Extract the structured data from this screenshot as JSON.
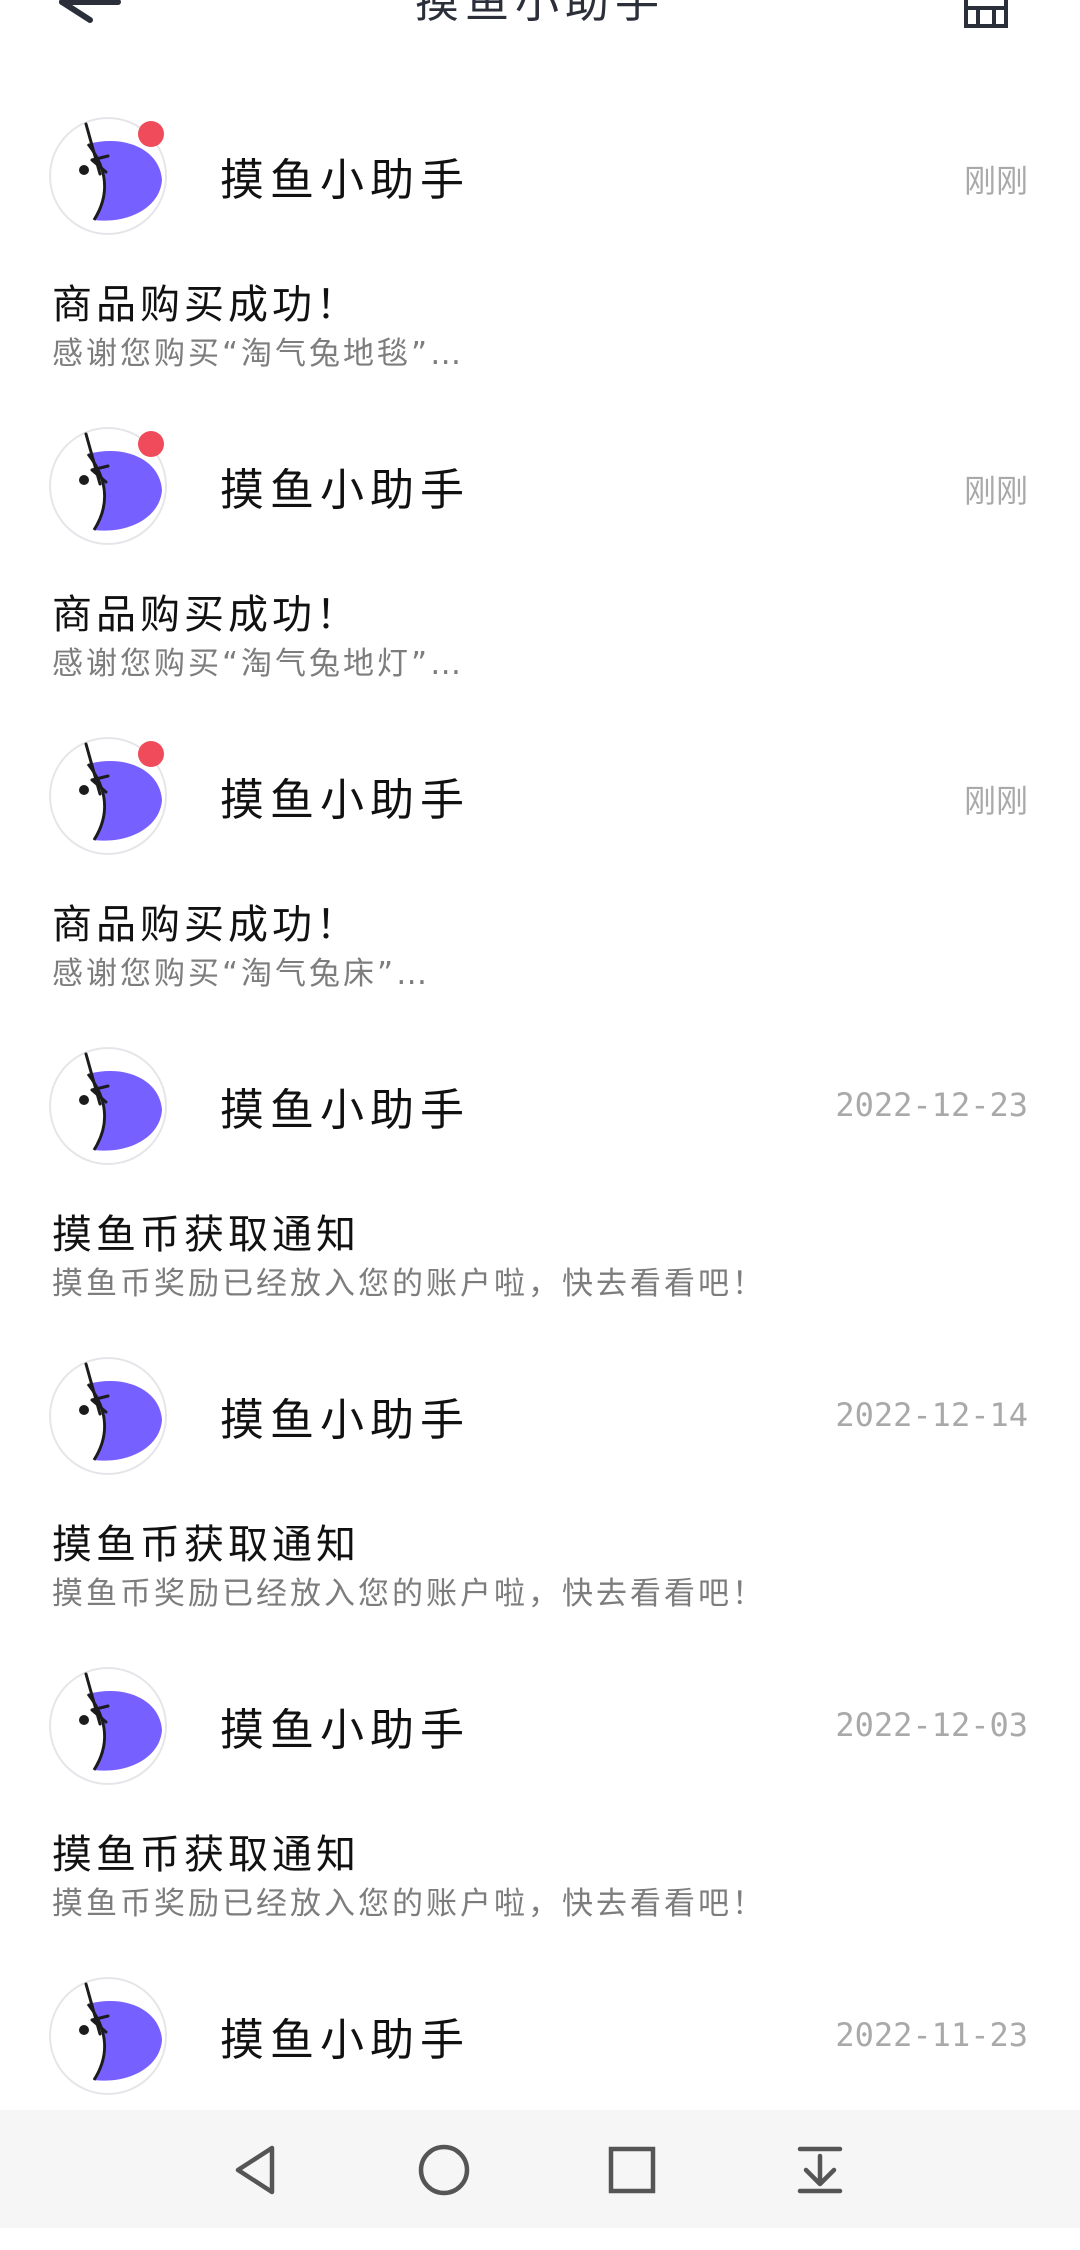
{
  "header": {
    "title": "摸鱼小助手",
    "back_icon": "back-arrow-icon",
    "clear_icon": "broom-clear-icon"
  },
  "colors": {
    "accent": "#7660ff",
    "unread_dot": "#ef4b5b",
    "time_text": "#a9a9a9",
    "desc_text": "#7d7d7d"
  },
  "messages": [
    {
      "sender": "摸鱼小助手",
      "time": "刚刚",
      "title": "商品购买成功！",
      "desc": "感谢您购买“淘气兔地毯”…",
      "unread": true
    },
    {
      "sender": "摸鱼小助手",
      "time": "刚刚",
      "title": "商品购买成功！",
      "desc": "感谢您购买“淘气兔地灯”…",
      "unread": true
    },
    {
      "sender": "摸鱼小助手",
      "time": "刚刚",
      "title": "商品购买成功！",
      "desc": "感谢您购买“淘气兔床”…",
      "unread": true
    },
    {
      "sender": "摸鱼小助手",
      "time": "2022-12-23",
      "title": "摸鱼币获取通知",
      "desc": "摸鱼币奖励已经放入您的账户啦，快去看看吧！",
      "unread": false
    },
    {
      "sender": "摸鱼小助手",
      "time": "2022-12-14",
      "title": "摸鱼币获取通知",
      "desc": "摸鱼币奖励已经放入您的账户啦，快去看看吧！",
      "unread": false
    },
    {
      "sender": "摸鱼小助手",
      "time": "2022-12-03",
      "title": "摸鱼币获取通知",
      "desc": "摸鱼币奖励已经放入您的账户啦，快去看看吧！",
      "unread": false
    },
    {
      "sender": "摸鱼小助手",
      "time": "2022-11-23",
      "title": "",
      "desc": "",
      "unread": false
    }
  ],
  "navbar": {
    "icons": [
      "nav-back-icon",
      "nav-home-icon",
      "nav-recents-icon",
      "nav-notification-icon"
    ]
  }
}
